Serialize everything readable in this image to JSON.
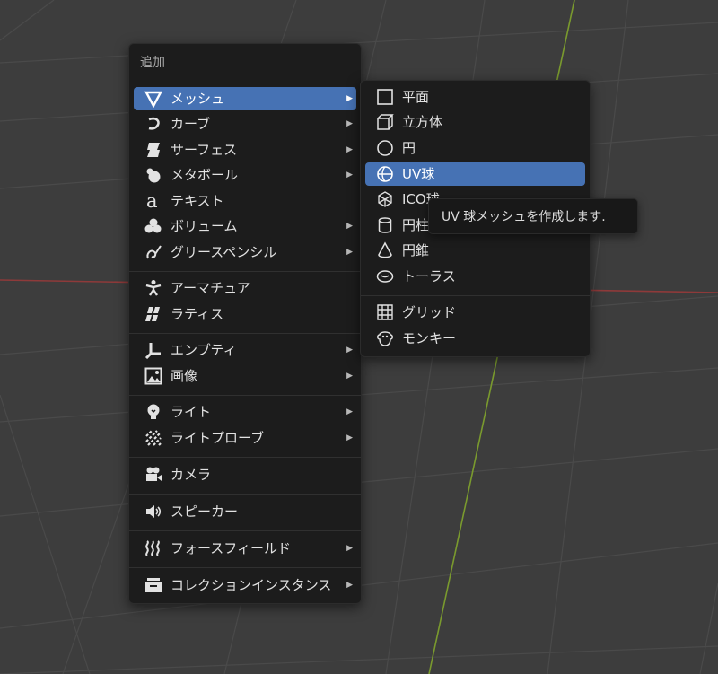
{
  "add_menu": {
    "title": "追加",
    "items": [
      {
        "label": "メッシュ",
        "icon": "mesh-icon",
        "has_submenu": true,
        "active": true
      },
      {
        "label": "カーブ",
        "icon": "curve-icon",
        "has_submenu": true
      },
      {
        "label": "サーフェス",
        "icon": "surface-icon",
        "has_submenu": true
      },
      {
        "label": "メタボール",
        "icon": "metaball-icon",
        "has_submenu": true
      },
      {
        "label": "テキスト",
        "icon": "text-icon",
        "has_submenu": false
      },
      {
        "label": "ボリューム",
        "icon": "volume-icon",
        "has_submenu": true
      },
      {
        "label": "グリースペンシル",
        "icon": "grease-pencil-icon",
        "has_submenu": true
      },
      {
        "label": "アーマチュア",
        "icon": "armature-icon",
        "has_submenu": false
      },
      {
        "label": "ラティス",
        "icon": "lattice-icon",
        "has_submenu": false
      },
      {
        "label": "エンプティ",
        "icon": "empty-icon",
        "has_submenu": true
      },
      {
        "label": "画像",
        "icon": "image-icon",
        "has_submenu": true
      },
      {
        "label": "ライト",
        "icon": "light-icon",
        "has_submenu": true
      },
      {
        "label": "ライトプローブ",
        "icon": "light-probe-icon",
        "has_submenu": true
      },
      {
        "label": "カメラ",
        "icon": "camera-icon",
        "has_submenu": false
      },
      {
        "label": "スピーカー",
        "icon": "speaker-icon",
        "has_submenu": false
      },
      {
        "label": "フォースフィールド",
        "icon": "force-field-icon",
        "has_submenu": true
      },
      {
        "label": "コレクションインスタンス",
        "icon": "collection-instance-icon",
        "has_submenu": true
      }
    ]
  },
  "mesh_submenu": {
    "items": [
      {
        "label": "平面",
        "icon": "plane-icon"
      },
      {
        "label": "立方体",
        "icon": "cube-icon"
      },
      {
        "label": "円",
        "icon": "circle-icon"
      },
      {
        "label": "UV球",
        "icon": "uv-sphere-icon",
        "active": true
      },
      {
        "label": "ICO球",
        "icon": "ico-sphere-icon"
      },
      {
        "label": "円柱",
        "icon": "cylinder-icon"
      },
      {
        "label": "円錐",
        "icon": "cone-icon"
      },
      {
        "label": "トーラス",
        "icon": "torus-icon"
      },
      {
        "label": "グリッド",
        "icon": "grid-icon"
      },
      {
        "label": "モンキー",
        "icon": "monkey-icon"
      }
    ]
  },
  "tooltip": {
    "text": "UV 球メッシュを作成します."
  },
  "submenu_arrow": "▶",
  "colors": {
    "viewport_bg": "#3d3d3d",
    "menu_bg": "#1c1c1c",
    "highlight": "#4672b4",
    "x_axis": "#8e3a3a",
    "y_axis": "#7a9a2e"
  }
}
